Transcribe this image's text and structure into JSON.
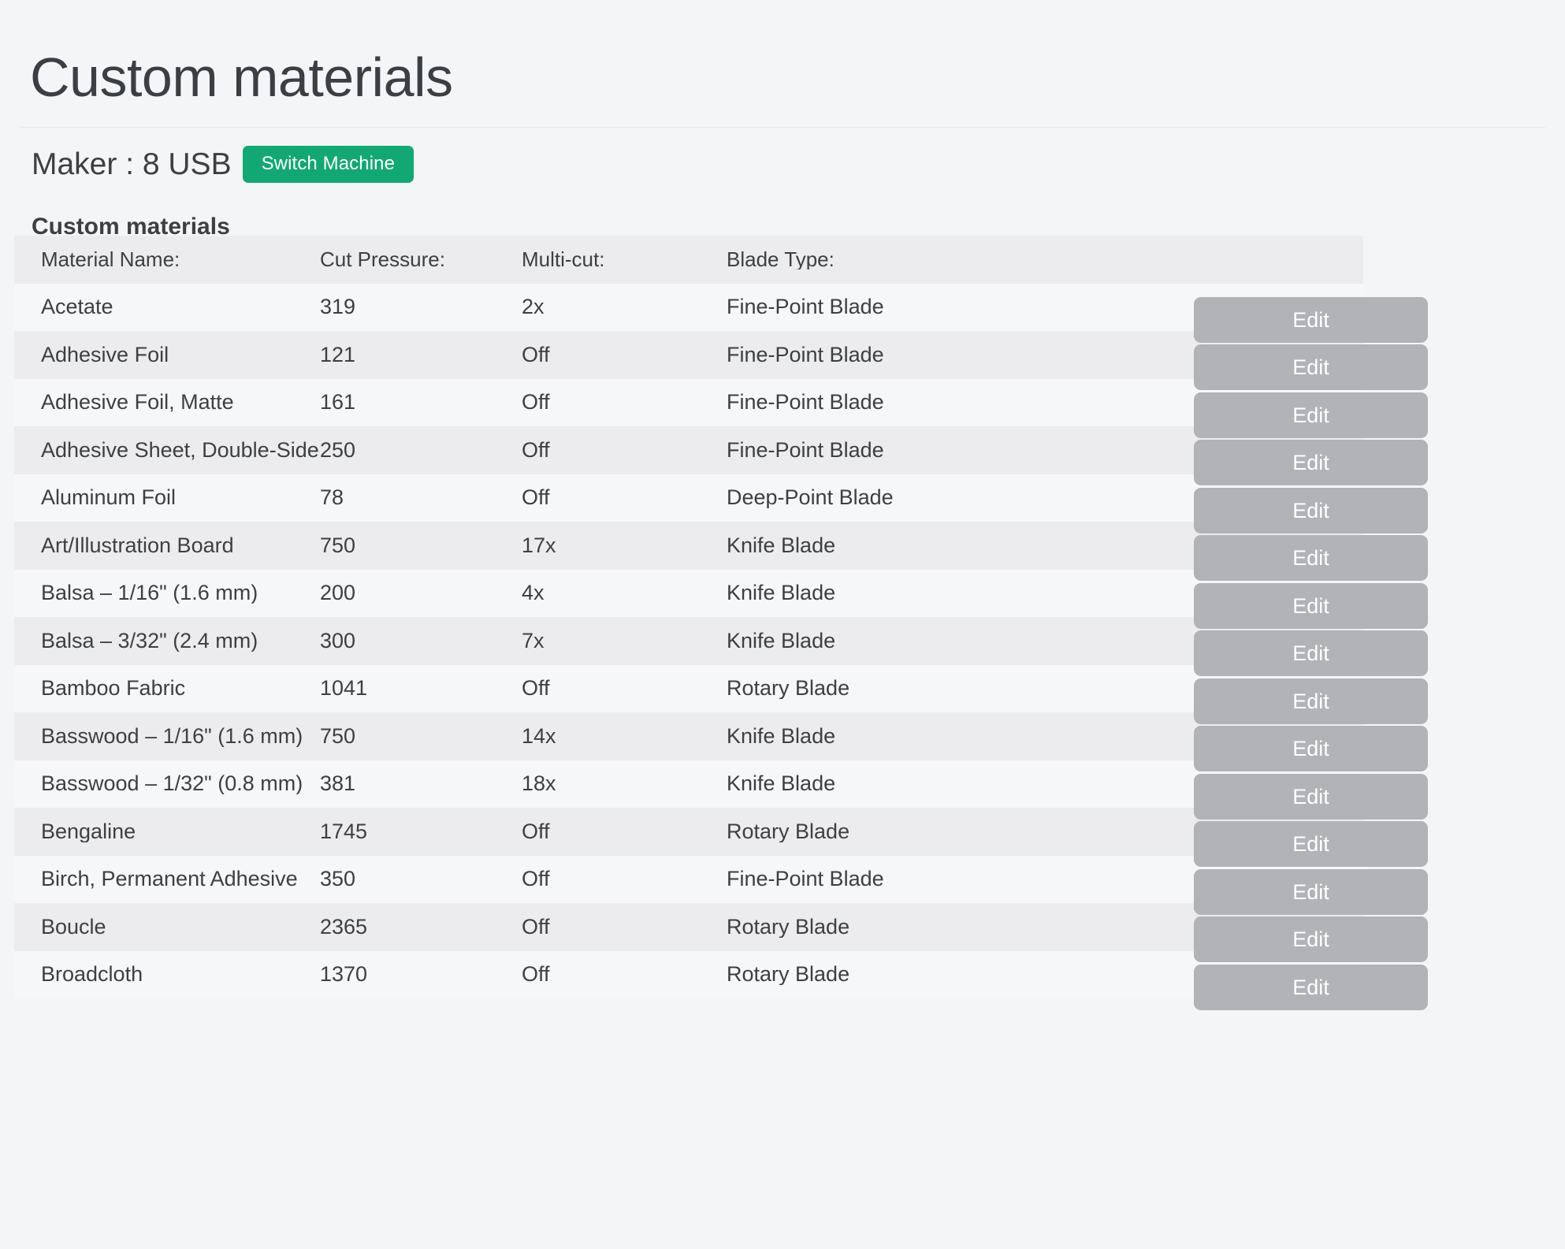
{
  "page": {
    "title": "Custom materials"
  },
  "machine": {
    "label": "Maker : 8 USB",
    "switch_button": "Switch Machine",
    "accent_color": "#12a874"
  },
  "section": {
    "heading": "Custom materials"
  },
  "table": {
    "columns": [
      "Material Name:",
      "Cut Pressure:",
      "Multi-cut:",
      "Blade Type:"
    ],
    "action_label": "Edit",
    "rows": [
      {
        "name": "Acetate",
        "pressure": "319",
        "multicut": "2x",
        "blade": "Fine-Point Blade",
        "action": "Edit"
      },
      {
        "name": "Adhesive Foil",
        "pressure": "121",
        "multicut": "Off",
        "blade": "Fine-Point Blade",
        "action": "Edit"
      },
      {
        "name": "Adhesive Foil, Matte",
        "pressure": "161",
        "multicut": "Off",
        "blade": "Fine-Point Blade",
        "action": "Edit"
      },
      {
        "name": "Adhesive Sheet, Double-Sided",
        "pressure": "250",
        "multicut": "Off",
        "blade": "Fine-Point Blade",
        "action": "Edit"
      },
      {
        "name": "Aluminum Foil",
        "pressure": "78",
        "multicut": "Off",
        "blade": "Deep-Point Blade",
        "action": "Edit"
      },
      {
        "name": "Art/Illustration Board",
        "pressure": "750",
        "multicut": "17x",
        "blade": "Knife Blade",
        "action": "Edit"
      },
      {
        "name": "Balsa – 1/16\" (1.6 mm)",
        "pressure": "200",
        "multicut": "4x",
        "blade": "Knife Blade",
        "action": "Edit"
      },
      {
        "name": "Balsa – 3/32\" (2.4 mm)",
        "pressure": "300",
        "multicut": "7x",
        "blade": "Knife Blade",
        "action": "Edit"
      },
      {
        "name": "Bamboo Fabric",
        "pressure": "1041",
        "multicut": "Off",
        "blade": "Rotary Blade",
        "action": "Edit"
      },
      {
        "name": "Basswood – 1/16\" (1.6 mm)",
        "pressure": "750",
        "multicut": "14x",
        "blade": "Knife Blade",
        "action": "Edit"
      },
      {
        "name": "Basswood – 1/32\" (0.8 mm)",
        "pressure": "381",
        "multicut": "18x",
        "blade": "Knife Blade",
        "action": "Edit"
      },
      {
        "name": "Bengaline",
        "pressure": "1745",
        "multicut": "Off",
        "blade": "Rotary Blade",
        "action": "Edit"
      },
      {
        "name": "Birch, Permanent Adhesive",
        "pressure": "350",
        "multicut": "Off",
        "blade": "Fine-Point Blade",
        "action": "Edit"
      },
      {
        "name": "Boucle",
        "pressure": "2365",
        "multicut": "Off",
        "blade": "Rotary Blade",
        "action": "Edit"
      },
      {
        "name": "Broadcloth",
        "pressure": "1370",
        "multicut": "Off",
        "blade": "Rotary Blade",
        "action": "Edit"
      }
    ]
  }
}
